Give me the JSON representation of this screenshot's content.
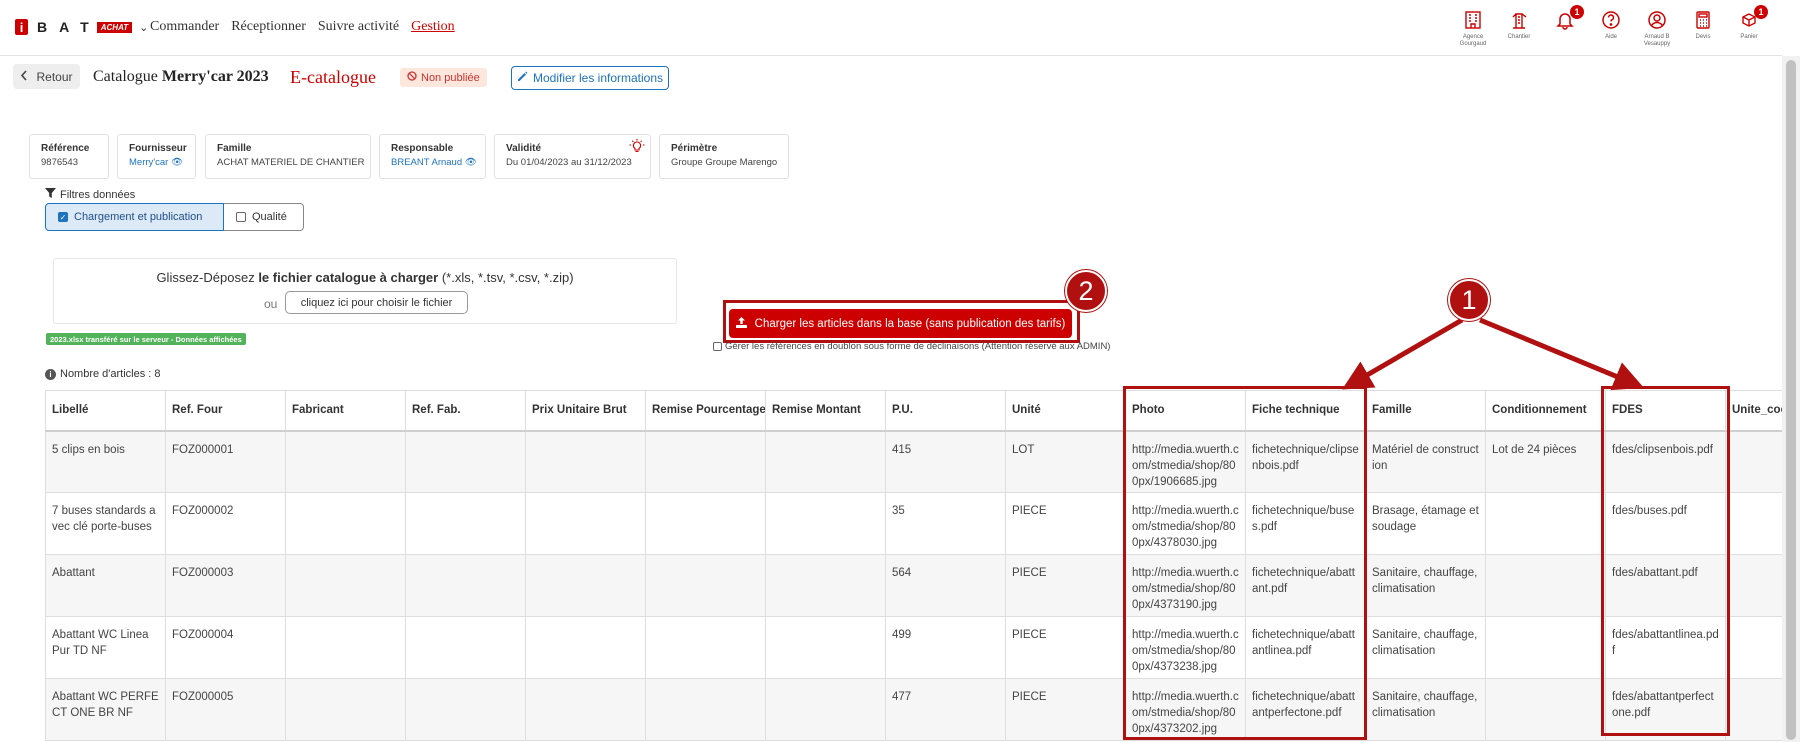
{
  "nav": {
    "logo_i": "i",
    "logo_letters": "BAT",
    "logo_tag": "ACHAT",
    "menu": [
      {
        "label": "Commander",
        "active": false
      },
      {
        "label": "Réceptionner",
        "active": false
      },
      {
        "label": "Suivre activité",
        "active": false
      },
      {
        "label": "Gestion",
        "active": true
      }
    ],
    "icons": [
      {
        "icon": "building-icon",
        "caption": "Agence Gourgaud",
        "badge": ""
      },
      {
        "icon": "crane-icon",
        "caption": "Chantier",
        "badge": ""
      },
      {
        "icon": "bell-icon",
        "caption": "",
        "badge": "1"
      },
      {
        "icon": "help-icon",
        "caption": "Aide",
        "badge": ""
      },
      {
        "icon": "user-icon",
        "caption": "Arnaud B Vesauppy",
        "badge": ""
      },
      {
        "icon": "calculator-icon",
        "caption": "Devis",
        "badge": ""
      },
      {
        "icon": "cart-icon",
        "caption": "Panier",
        "badge": "1"
      }
    ]
  },
  "header": {
    "back_label": "Retour",
    "title_prefix": "Catalogue",
    "title_name": "Merry'car 2023",
    "ecatalogue": "E-catalogue",
    "status": "Non publiée",
    "modify_label": "Modifier les informations"
  },
  "cards": [
    {
      "label": "Référence",
      "value": "9876543",
      "link": false
    },
    {
      "label": "Fournisseur",
      "value": "Merry'car",
      "link": true
    },
    {
      "label": "Famille",
      "value": "ACHAT MATERIEL DE CHANTIER",
      "link": false
    },
    {
      "label": "Responsable",
      "value": "BREANT Arnaud",
      "link": true
    },
    {
      "label": "Validité",
      "value": "Du 01/04/2023 au 31/12/2023",
      "link": false
    },
    {
      "label": "Périmètre",
      "value": "Groupe Groupe Marengo",
      "link": false
    }
  ],
  "filters": {
    "label": "Filtres données",
    "tab_loading": "Chargement et publication",
    "tab_quality": "Qualité"
  },
  "dropzone": {
    "text_pre": "Glissez-Déposez ",
    "text_bold": "le fichier catalogue à charger",
    "text_post": " (*.xls, *.tsv, *.csv, *.zip)",
    "or": "ou",
    "choose_button": "cliquez ici pour choisir le fichier",
    "success": "2023.xlsx transféré sur le serveur - Données affichées"
  },
  "load": {
    "button": "Charger les articles dans la base (sans publication des tarifs)",
    "duplicates": "Gérer les références en doublon sous forme de déclinaisons (Attention réservé aux ADMIN)"
  },
  "annotations": {
    "one": "1",
    "two": "2"
  },
  "article_count": "Nombre d'articles : 8",
  "table": {
    "headers": [
      "Libellé",
      "Ref. Four",
      "Fabricant",
      "Ref. Fab.",
      "Prix Unitaire Brut",
      "Remise Pourcentage",
      "Remise Montant",
      "P.U.",
      "Unité",
      "Photo",
      "Fiche technique",
      "Famille",
      "Conditionnement",
      "FDES",
      "Unite_coeff"
    ],
    "rows": [
      [
        "5 clips en bois",
        "FOZ000001",
        "",
        "",
        "",
        "",
        "",
        "415",
        "LOT",
        "http://media.wuerth.com/stmedia/shop/800px/1906685.jpg",
        "fichetechnique/clipsenbois.pdf",
        "Matériel de construction",
        "Lot de 24 pièces",
        "fdes/clipsenbois.pdf",
        ""
      ],
      [
        "7 buses standards avec clé porte-buses",
        "FOZ000002",
        "",
        "",
        "",
        "",
        "",
        "35",
        "PIECE",
        "http://media.wuerth.com/stmedia/shop/800px/4378030.jpg",
        "fichetechnique/buses.pdf",
        "Brasage, étamage et soudage",
        "",
        "fdes/buses.pdf",
        ""
      ],
      [
        "Abattant",
        "FOZ000003",
        "",
        "",
        "",
        "",
        "",
        "564",
        "PIECE",
        "http://media.wuerth.com/stmedia/shop/800px/4373190.jpg",
        "fichetechnique/abattant.pdf",
        "Sanitaire, chauffage, climatisation",
        "",
        "fdes/abattant.pdf",
        ""
      ],
      [
        "Abattant WC Linea Pur TD NF",
        "FOZ000004",
        "",
        "",
        "",
        "",
        "",
        "499",
        "PIECE",
        "http://media.wuerth.com/stmedia/shop/800px/4373238.jpg",
        "fichetechnique/abattantlinea.pdf",
        "Sanitaire, chauffage, climatisation",
        "",
        "fdes/abattantlinea.pdf",
        ""
      ],
      [
        "Abattant WC PERFECT ONE BR NF",
        "FOZ000005",
        "",
        "",
        "",
        "",
        "",
        "477",
        "PIECE",
        "http://media.wuerth.com/stmedia/shop/800px/4373202.jpg",
        "fichetechnique/abattantperfectone.pdf",
        "Sanitaire, chauffage, climatisation",
        "",
        "fdes/abattantperfectone.pdf",
        ""
      ]
    ]
  }
}
